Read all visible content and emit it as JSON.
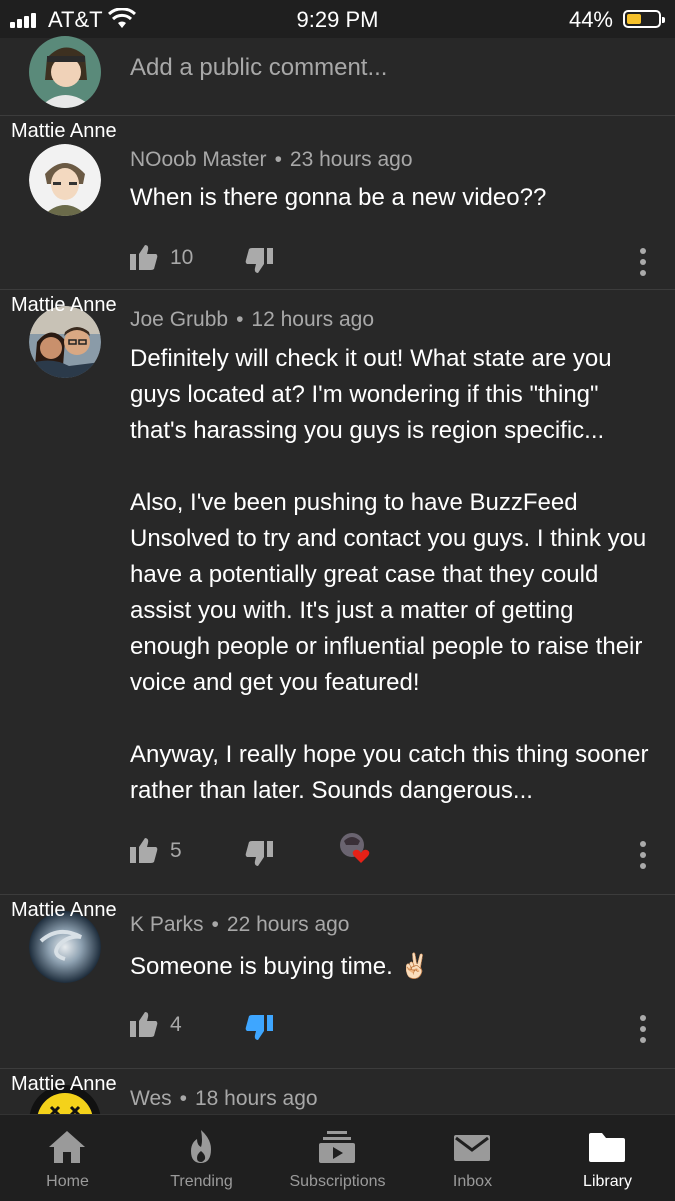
{
  "status_bar": {
    "carrier": "AT&T",
    "time": "9:29 PM",
    "battery": "44%"
  },
  "add_comment": {
    "placeholder": "Add a public comment..."
  },
  "comments": [
    {
      "overlay_name": "Mattie Anne",
      "author": "NOoob Master",
      "time": "23 hours ago",
      "paragraphs": [
        "When is there gonna be a new video??"
      ],
      "likes": "10"
    },
    {
      "overlay_name": "Mattie Anne",
      "author": "Joe Grubb",
      "time": "12 hours ago",
      "paragraphs": [
        "Definitely will check it out! What state are you guys located at? I'm wondering if this \"thing\" that's harassing you guys is region specific...",
        "Also, I've been pushing to have BuzzFeed Unsolved to try and contact you guys. I think you have a potentially great case that they could assist you with. It's just a matter of getting enough people or influential people to raise their voice and get you featured!",
        "Anyway, I really hope you catch this thing sooner rather than later. Sounds dangerous..."
      ],
      "likes": "5"
    },
    {
      "overlay_name": "Mattie Anne",
      "author": "K Parks",
      "time": "22 hours ago",
      "paragraphs": [
        "Someone is buying time. ✌🏻"
      ],
      "likes": "4"
    },
    {
      "overlay_name": "Mattie Anne",
      "author": "Wes",
      "time": "18 hours ago"
    }
  ],
  "tabs": [
    {
      "label": "Home",
      "icon": "home-icon"
    },
    {
      "label": "Trending",
      "icon": "flame-icon"
    },
    {
      "label": "Subscriptions",
      "icon": "subscriptions-icon"
    },
    {
      "label": "Inbox",
      "icon": "mail-icon"
    },
    {
      "label": "Library",
      "icon": "folder-icon"
    }
  ],
  "colors": {
    "background": "#282828",
    "bar": "#1f1f1f",
    "dislike_active": "#3ea6ff",
    "heart": "#e62117",
    "battery": "#f6c12b"
  }
}
